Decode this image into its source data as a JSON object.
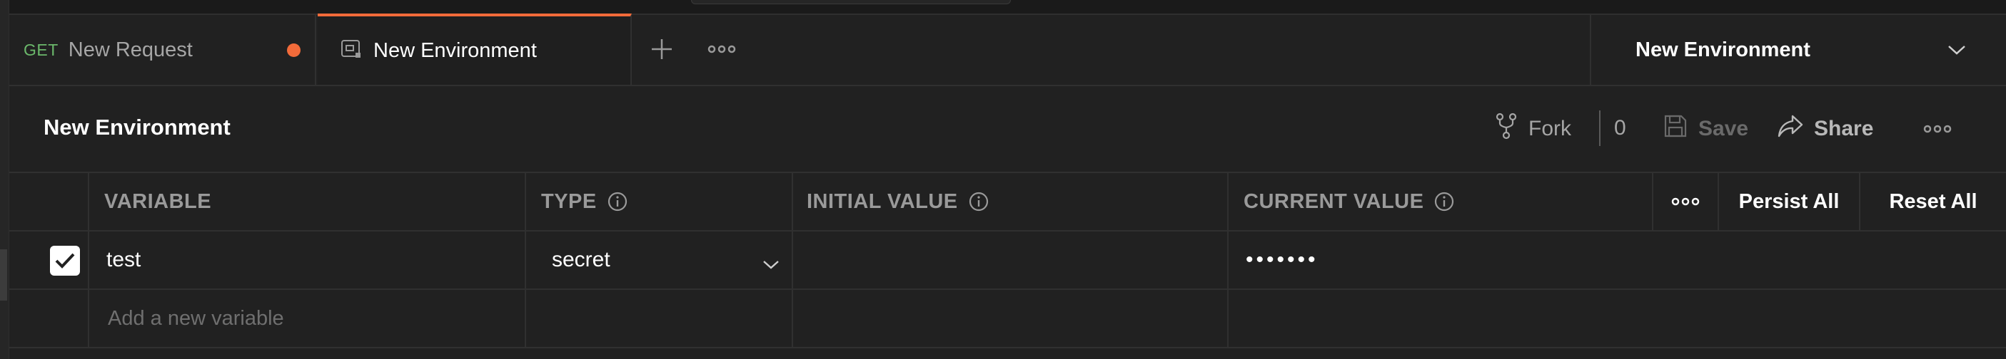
{
  "tabs": [
    {
      "method": "GET",
      "label": "New Request",
      "unsaved": true
    },
    {
      "label": "New Environment",
      "active": true
    }
  ],
  "tab_icons": {
    "add": "plus-icon",
    "more": "more-horizontal-icon",
    "environment": "environment-icon"
  },
  "environment_selector": {
    "label": "New Environment"
  },
  "header": {
    "title": "New Environment",
    "fork_label": "Fork",
    "fork_count": "0",
    "save_label": "Save",
    "share_label": "Share"
  },
  "table": {
    "columns": [
      "VARIABLE",
      "TYPE",
      "INITIAL VALUE",
      "CURRENT VALUE"
    ],
    "actions": {
      "persist_all": "Persist All",
      "reset_all": "Reset All"
    },
    "rows": [
      {
        "enabled": true,
        "variable": "test",
        "type": "secret",
        "initial_value": "",
        "current_value": "•••••••"
      }
    ],
    "new_row_placeholder": "Add a new variable"
  },
  "colors": {
    "accent": "#f26b3a",
    "background": "#212121",
    "get_method": "#6bb86b"
  }
}
